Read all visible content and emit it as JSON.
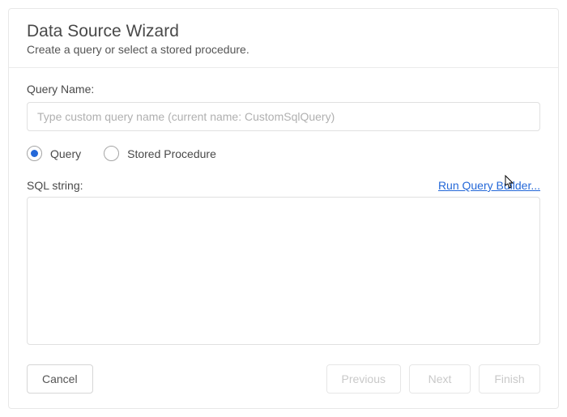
{
  "header": {
    "title": "Data Source Wizard",
    "subtitle": "Create a query or select a stored procedure."
  },
  "form": {
    "queryNameLabel": "Query Name:",
    "queryNamePlaceholder": "Type custom query name (current name: CustomSqlQuery)",
    "queryNameValue": "",
    "radio": {
      "query": "Query",
      "storedProcedure": "Stored Procedure",
      "selected": "query"
    },
    "sqlLabel": "SQL string:",
    "runLink": "Run Query Builder...",
    "sqlValue": ""
  },
  "footer": {
    "cancel": "Cancel",
    "previous": "Previous",
    "next": "Next",
    "finish": "Finish"
  }
}
